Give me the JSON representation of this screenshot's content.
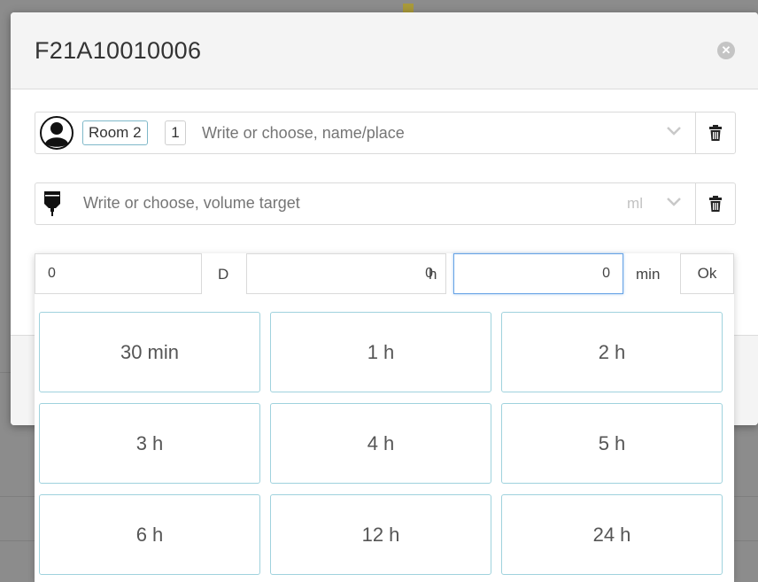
{
  "modal": {
    "title": "F21A10010006",
    "close_icon": "close-circle-icon"
  },
  "assignee": {
    "icon": "user-avatar-icon",
    "room_tag": "Room 2",
    "count_tag": "1",
    "placeholder": "Write or choose, name/place"
  },
  "volume": {
    "icon": "iv-drip-icon",
    "placeholder": "Write or choose, volume target",
    "unit": "ml"
  },
  "time": {
    "days_value": "0",
    "days_unit": "D",
    "hours_value": "0",
    "hours_unit": "h",
    "minutes_value": "0",
    "minutes_unit": "min",
    "ok_label": "Ok"
  },
  "presets": [
    "30 min",
    "1 h",
    "2 h",
    "3 h",
    "4 h",
    "5 h",
    "6 h",
    "12 h",
    "24 h"
  ],
  "colors": {
    "accent_border": "#9fd2dd",
    "focus_border": "#66a3e6",
    "room_tag_border": "#7fb8c9"
  }
}
